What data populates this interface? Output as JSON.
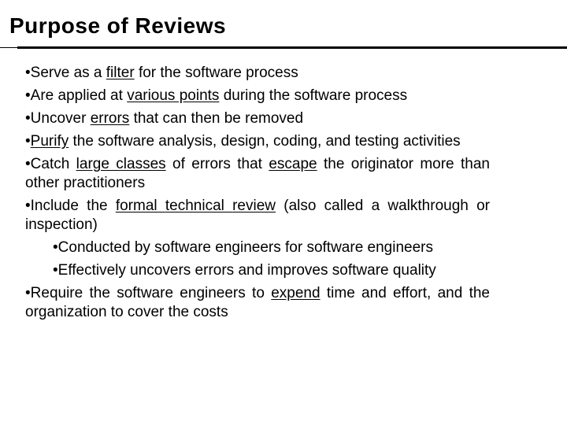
{
  "slide": {
    "title": "Purpose of Reviews",
    "bullet_glyph": "•",
    "items": [
      {
        "level": 1,
        "segments": [
          {
            "text": "Serve as a ",
            "underline": false
          },
          {
            "text": "filter",
            "underline": true
          },
          {
            "text": " for the software process",
            "underline": false
          }
        ]
      },
      {
        "level": 1,
        "segments": [
          {
            "text": "Are applied at ",
            "underline": false
          },
          {
            "text": "various points",
            "underline": true
          },
          {
            "text": " during the software process",
            "underline": false
          }
        ]
      },
      {
        "level": 1,
        "segments": [
          {
            "text": "Uncover ",
            "underline": false
          },
          {
            "text": "errors",
            "underline": true
          },
          {
            "text": " that can then be removed",
            "underline": false
          }
        ]
      },
      {
        "level": 1,
        "segments": [
          {
            "text": "Purify",
            "underline": true
          },
          {
            "text": " the software analysis, design, coding, and testing activities",
            "underline": false
          }
        ]
      },
      {
        "level": 1,
        "segments": [
          {
            "text": "Catch ",
            "underline": false
          },
          {
            "text": "large classes",
            "underline": true
          },
          {
            "text": " of errors that ",
            "underline": false
          },
          {
            "text": "escape",
            "underline": true
          },
          {
            "text": " the originator more than other practitioners",
            "underline": false
          }
        ]
      },
      {
        "level": 1,
        "segments": [
          {
            "text": "Include the ",
            "underline": false
          },
          {
            "text": "formal ",
            "underline": true
          },
          {
            "text": " ",
            "underline": false
          },
          {
            "text": "technical ",
            "underline": true
          },
          {
            "text": " ",
            "underline": false
          },
          {
            "text": "review",
            "underline": true
          },
          {
            "text": " (also called a walkthrough or inspection)",
            "underline": false
          }
        ]
      },
      {
        "level": 2,
        "segments": [
          {
            "text": "Conducted by software engineers for software engineers",
            "underline": false
          }
        ]
      },
      {
        "level": 2,
        "segments": [
          {
            "text": "Effectively uncovers errors and improves software quality",
            "underline": false
          }
        ]
      },
      {
        "level": 1,
        "segments": [
          {
            "text": "Require the software engineers to ",
            "underline": false
          },
          {
            "text": "expend",
            "underline": true
          },
          {
            "text": " time and effort, and the organization to cover the costs",
            "underline": false
          }
        ]
      }
    ]
  }
}
